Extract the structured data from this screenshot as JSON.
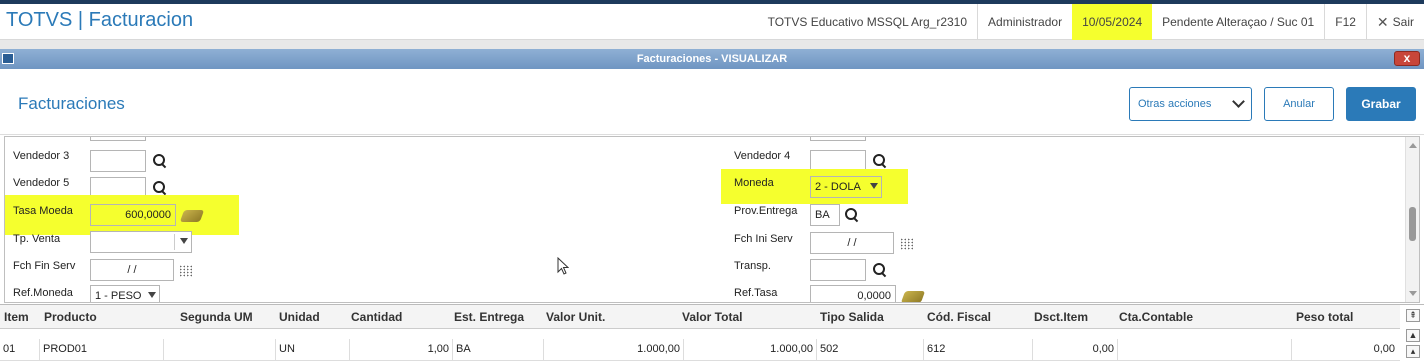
{
  "app": {
    "title": "TOTVS | Facturacion",
    "environment": "TOTVS Educativo MSSQL Arg_r2310",
    "user": "Administrador",
    "date": "10/05/2024",
    "branch": "Pendente Alteraçao / Suc 01",
    "f12": "F12",
    "exit_label": "Sair"
  },
  "window": {
    "title": "Facturaciones - VISUALIZAR",
    "close_label": "x"
  },
  "header": {
    "title": "Facturaciones",
    "otras_label": "Otras acciones",
    "anular_label": "Anular",
    "grabar_label": "Grabar"
  },
  "form": {
    "vendedor3": {
      "label": "Vendedor 3",
      "value": ""
    },
    "vendedor4": {
      "label": "Vendedor 4",
      "value": ""
    },
    "vendedor5": {
      "label": "Vendedor 5",
      "value": ""
    },
    "moneda": {
      "label": "Moneda",
      "value": "2 - DOLA"
    },
    "tasa_moeda": {
      "label": "Tasa Moeda",
      "value": "600,0000"
    },
    "prov_entrega": {
      "label": "Prov.Entrega",
      "value": "BA"
    },
    "tp_venta": {
      "label": "Tp. Venta",
      "value": ""
    },
    "fch_ini_serv": {
      "label": "Fch Ini Serv",
      "value": "/ /"
    },
    "fch_fin_serv": {
      "label": "Fch Fin Serv",
      "value": "/ /"
    },
    "transp": {
      "label": "Transp.",
      "value": ""
    },
    "ref_moneda": {
      "label": "Ref.Moneda",
      "value": "1 - PESO"
    },
    "ref_tasa": {
      "label": "Ref.Tasa",
      "value": "0,0000"
    }
  },
  "grid": {
    "headers": [
      "Item",
      "Producto",
      "Segunda UM",
      "Unidad",
      "Cantidad",
      "Est. Entrega",
      "Valor Unit.",
      "Valor Total",
      "Tipo Salida",
      "Cód. Fiscal",
      "Dsct.Item",
      "Cta.Contable",
      "Peso total"
    ],
    "rows": [
      {
        "item": "01",
        "producto": "PROD01",
        "segunda_um": "",
        "unidad": "UN",
        "cantidad": "1,00",
        "est_entrega": "BA",
        "valor_unit": "1.000,00",
        "valor_total": "1.000,00",
        "tipo_salida": "502",
        "cod_fiscal": "612",
        "dsct_item": "0,00",
        "cta_contable": "",
        "peso_total": "0,00"
      }
    ]
  },
  "colors": {
    "accent": "#2b7ab8",
    "highlight": "#f5ff2e",
    "window_title": "#6f95c2"
  }
}
